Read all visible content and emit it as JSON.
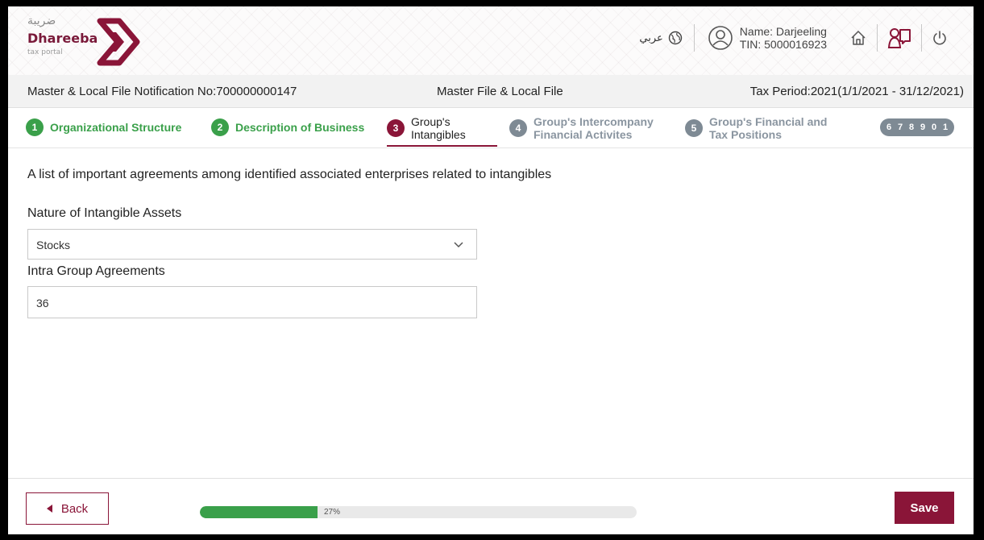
{
  "header": {
    "logo": {
      "arabic": "ضريبة",
      "name": "Dhareeba",
      "sub": "tax portal"
    },
    "language_label": "عربي",
    "user": {
      "name": "Name: Darjeeling",
      "tin": "TIN: 5000016923"
    }
  },
  "infobar": {
    "notification": "Master & Local File Notification No:700000000147",
    "file_type": "Master File & Local File",
    "tax_period": "Tax Period:2021(1/1/2021 - 31/12/2021)"
  },
  "stepper": {
    "steps": [
      {
        "num": "1",
        "line1": "Organizational Structure",
        "line2": "",
        "state": "done"
      },
      {
        "num": "2",
        "line1": "Description of Business",
        "line2": "",
        "state": "done"
      },
      {
        "num": "3",
        "line1": "Group's",
        "line2": "Intangibles",
        "state": "current"
      },
      {
        "num": "4",
        "line1": "Group's Intercompany",
        "line2": "Financial Activites",
        "state": "todo"
      },
      {
        "num": "5",
        "line1": "Group's Financial and",
        "line2": "Tax Positions",
        "state": "todo"
      }
    ],
    "more": [
      "6",
      "7",
      "8",
      "9",
      "0",
      "1"
    ]
  },
  "form": {
    "intro": "A list of important agreements among identified associated enterprises related to intangibles",
    "nature_label": "Nature of Intangible Assets",
    "nature_value": "Stocks",
    "agreements_label": "Intra Group Agreements",
    "agreements_value": "36"
  },
  "footer": {
    "back_label": "Back",
    "progress_value": 27,
    "progress_text": "27%",
    "save_label": "Save"
  },
  "colors": {
    "brand": "#8a1538",
    "success": "#3aa04a",
    "pending": "#7e8a94"
  }
}
